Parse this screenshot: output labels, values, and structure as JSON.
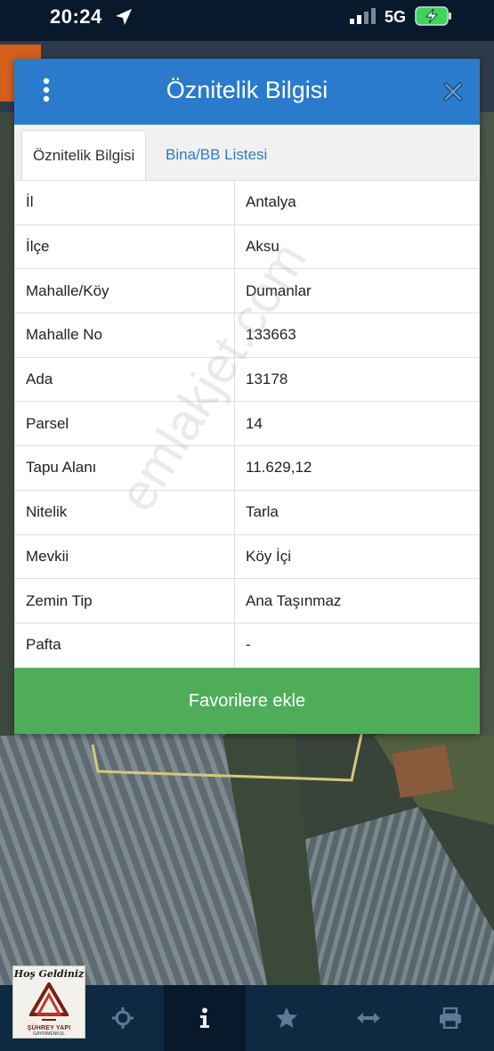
{
  "status_bar": {
    "time": "20:24",
    "network": "5G"
  },
  "dialog": {
    "title": "Öznitelik Bilgisi",
    "tabs": [
      {
        "label": "Öznitelik Bilgisi",
        "active": true
      },
      {
        "label": "Bina/BB Listesi",
        "active": false
      }
    ],
    "rows": [
      {
        "key": "İl",
        "value": "Antalya"
      },
      {
        "key": "İlçe",
        "value": "Aksu"
      },
      {
        "key": "Mahalle/Köy",
        "value": "Dumanlar"
      },
      {
        "key": "Mahalle No",
        "value": "133663"
      },
      {
        "key": "Ada",
        "value": "13178"
      },
      {
        "key": "Parsel",
        "value": "14"
      },
      {
        "key": "Tapu Alanı",
        "value": "11.629,12"
      },
      {
        "key": "Nitelik",
        "value": "Tarla"
      },
      {
        "key": "Mevkii",
        "value": "Köy İçi"
      },
      {
        "key": "Zemin Tip",
        "value": "Ana Taşınmaz"
      },
      {
        "key": "Pafta",
        "value": "-"
      }
    ],
    "favorite_button": "Favorilere ekle"
  },
  "watermark": "emlakjet.com",
  "logo": {
    "greeting": "Hoş Geldiniz",
    "name": "ŞÜHREY YAPI",
    "subtitle": "GAYRİMENKUL"
  },
  "bottom_nav": [
    {
      "icon": "logo-icon",
      "active": false
    },
    {
      "icon": "crosshair-icon",
      "active": false
    },
    {
      "icon": "info-icon",
      "active": true
    },
    {
      "icon": "star-icon",
      "active": false
    },
    {
      "icon": "measure-arrows-icon",
      "active": false
    },
    {
      "icon": "printer-icon",
      "active": false
    }
  ],
  "colors": {
    "header_blue": "#2b7bcc",
    "favorite_green": "#4fad5a",
    "nav_bg": "#0e2942"
  }
}
